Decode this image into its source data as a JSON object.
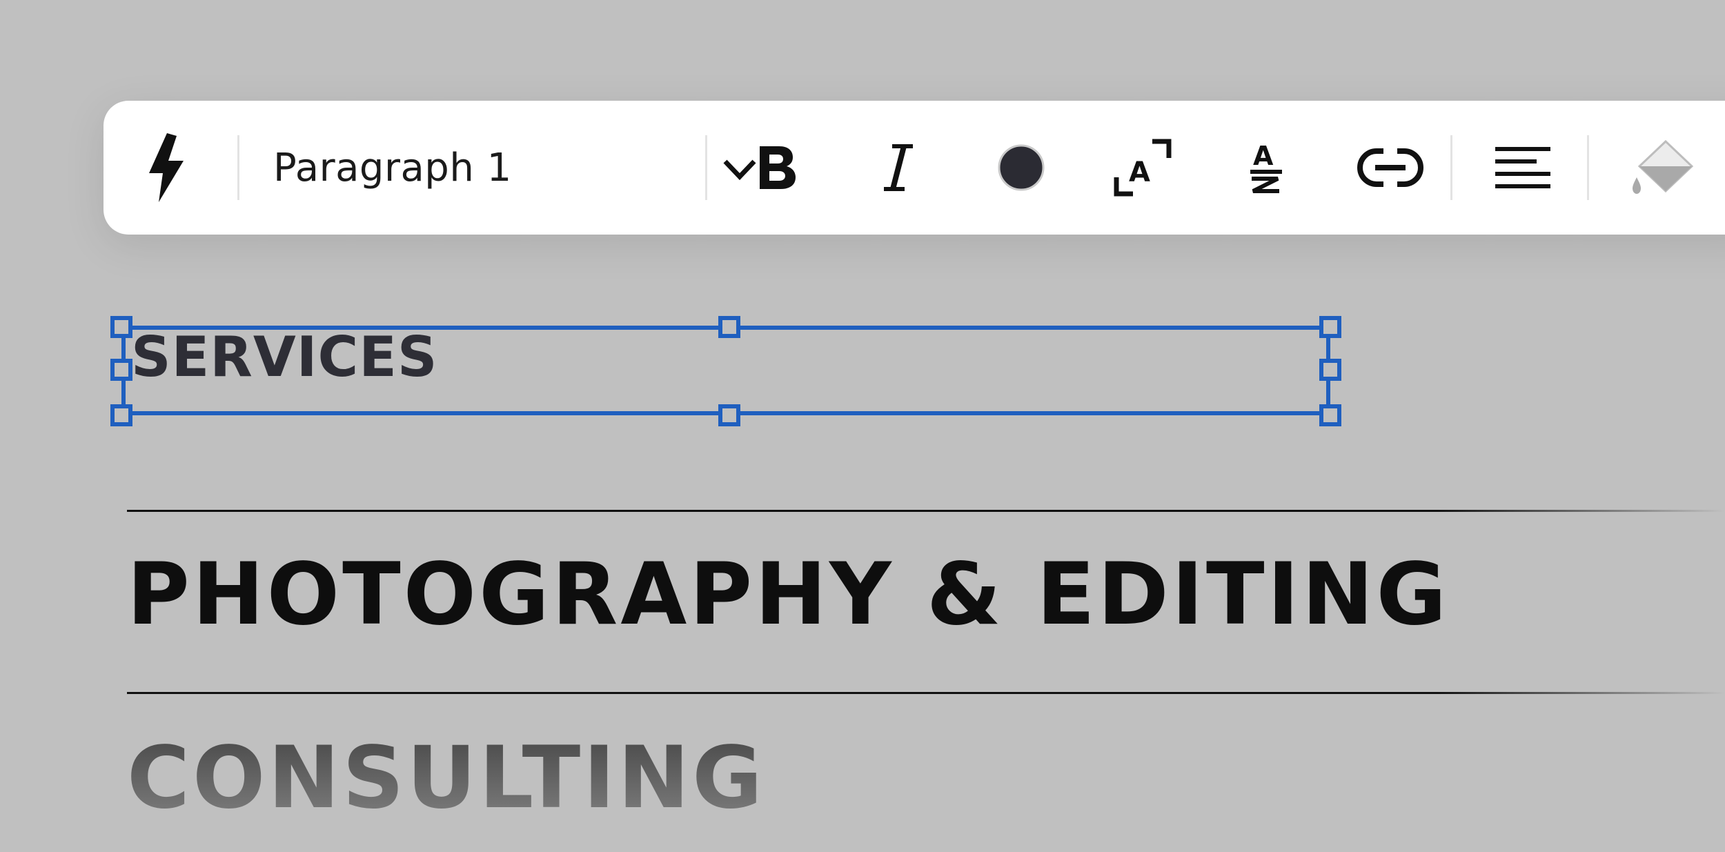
{
  "toolbar": {
    "text_style": "Paragraph 1",
    "icons": {
      "quick_actions": "lightning-bolt-icon",
      "style_dropdown": "chevron-down-icon",
      "bold": "bold-icon",
      "italic": "italic-icon",
      "text_color": "color-swatch",
      "text_size": "resize-text-icon",
      "strikethrough": "strikethrough-icon",
      "link": "link-icon",
      "align": "align-left-icon",
      "fill": "paint-bucket-icon"
    },
    "text_color_value": "#2b2b33"
  },
  "canvas": {
    "selected_text": "SERVICES",
    "services": [
      {
        "title": "PHOTOGRAPHY & EDITING"
      },
      {
        "title": "CONSULTING"
      }
    ]
  },
  "colors": {
    "background": "#c0c0c0",
    "selection": "#1f5fbf",
    "toolbar": "#ffffff"
  }
}
